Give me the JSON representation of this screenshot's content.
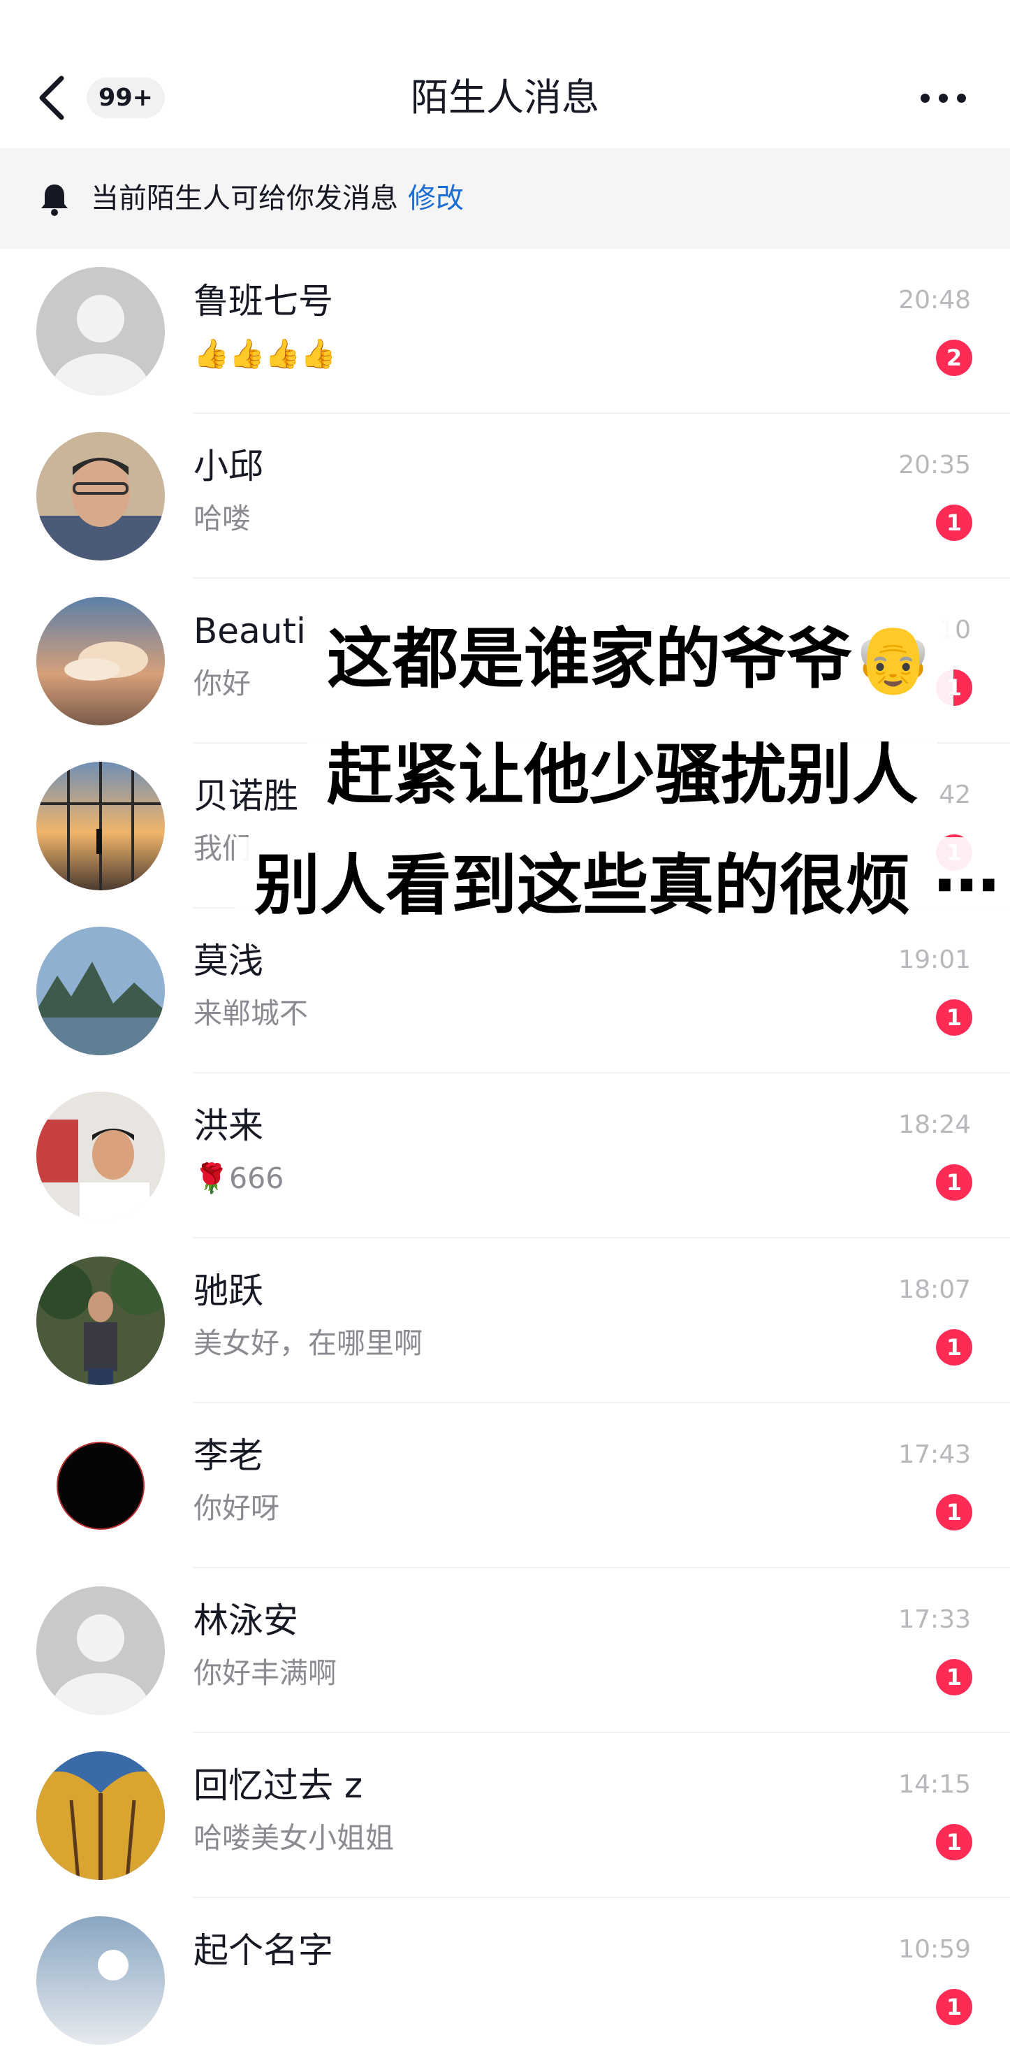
{
  "header": {
    "back_icon": "chevron-left-icon",
    "unread_badge": "99+",
    "title": "陌生人消息",
    "more_icon": "more-dots-icon"
  },
  "notice": {
    "icon": "bell-icon",
    "text": "当前陌生人可给你发消息",
    "action": "修改"
  },
  "conversations": [
    {
      "name": "鲁班七号",
      "preview": "👍👍👍👍",
      "time": "20:48",
      "unread": "2",
      "avatar": "default-avatar-icon"
    },
    {
      "name": "小邱",
      "preview": "哈喽",
      "time": "20:35",
      "unread": "1",
      "avatar": "person-photo"
    },
    {
      "name": "Beauti",
      "preview": "你好",
      "time": "10",
      "unread": "1",
      "avatar": "sunset-clouds-photo"
    },
    {
      "name": "贝诺胜",
      "preview": "我们",
      "time": "42",
      "unread": "1",
      "avatar": "airport-window-photo"
    },
    {
      "name": "莫浅",
      "preview": "来郸城不",
      "time": "19:01",
      "unread": "1",
      "avatar": "mountain-river-photo"
    },
    {
      "name": "洪来",
      "preview": "🌹666",
      "time": "18:24",
      "unread": "1",
      "avatar": "person-office-photo"
    },
    {
      "name": "驰跃",
      "preview": "美女好，在哪里啊",
      "time": "18:07",
      "unread": "1",
      "avatar": "person-trees-photo"
    },
    {
      "name": "李老",
      "preview": "你好呀",
      "time": "17:43",
      "unread": "1",
      "avatar": "black-circle-avatar"
    },
    {
      "name": "林泳安",
      "preview": "你好丰满啊",
      "time": "17:33",
      "unread": "1",
      "avatar": "default-avatar-icon"
    },
    {
      "name": "回忆过去 z",
      "preview": "哈喽美女小姐姐",
      "time": "14:15",
      "unread": "1",
      "avatar": "golden-trees-photo"
    },
    {
      "name": "起个名字",
      "preview": "",
      "time": "10:59",
      "unread": "1",
      "avatar": "sky-sun-photo"
    }
  ],
  "caption": {
    "line1": "这都是谁家的爷爷👴",
    "line2": "赶紧让他少骚扰别人",
    "line3": "别人看到这些真的很烦 ⋯"
  },
  "colors": {
    "accent_link": "#1a6ed3",
    "badge_red": "#fe2c55",
    "notice_bg": "#f5f5f5"
  }
}
